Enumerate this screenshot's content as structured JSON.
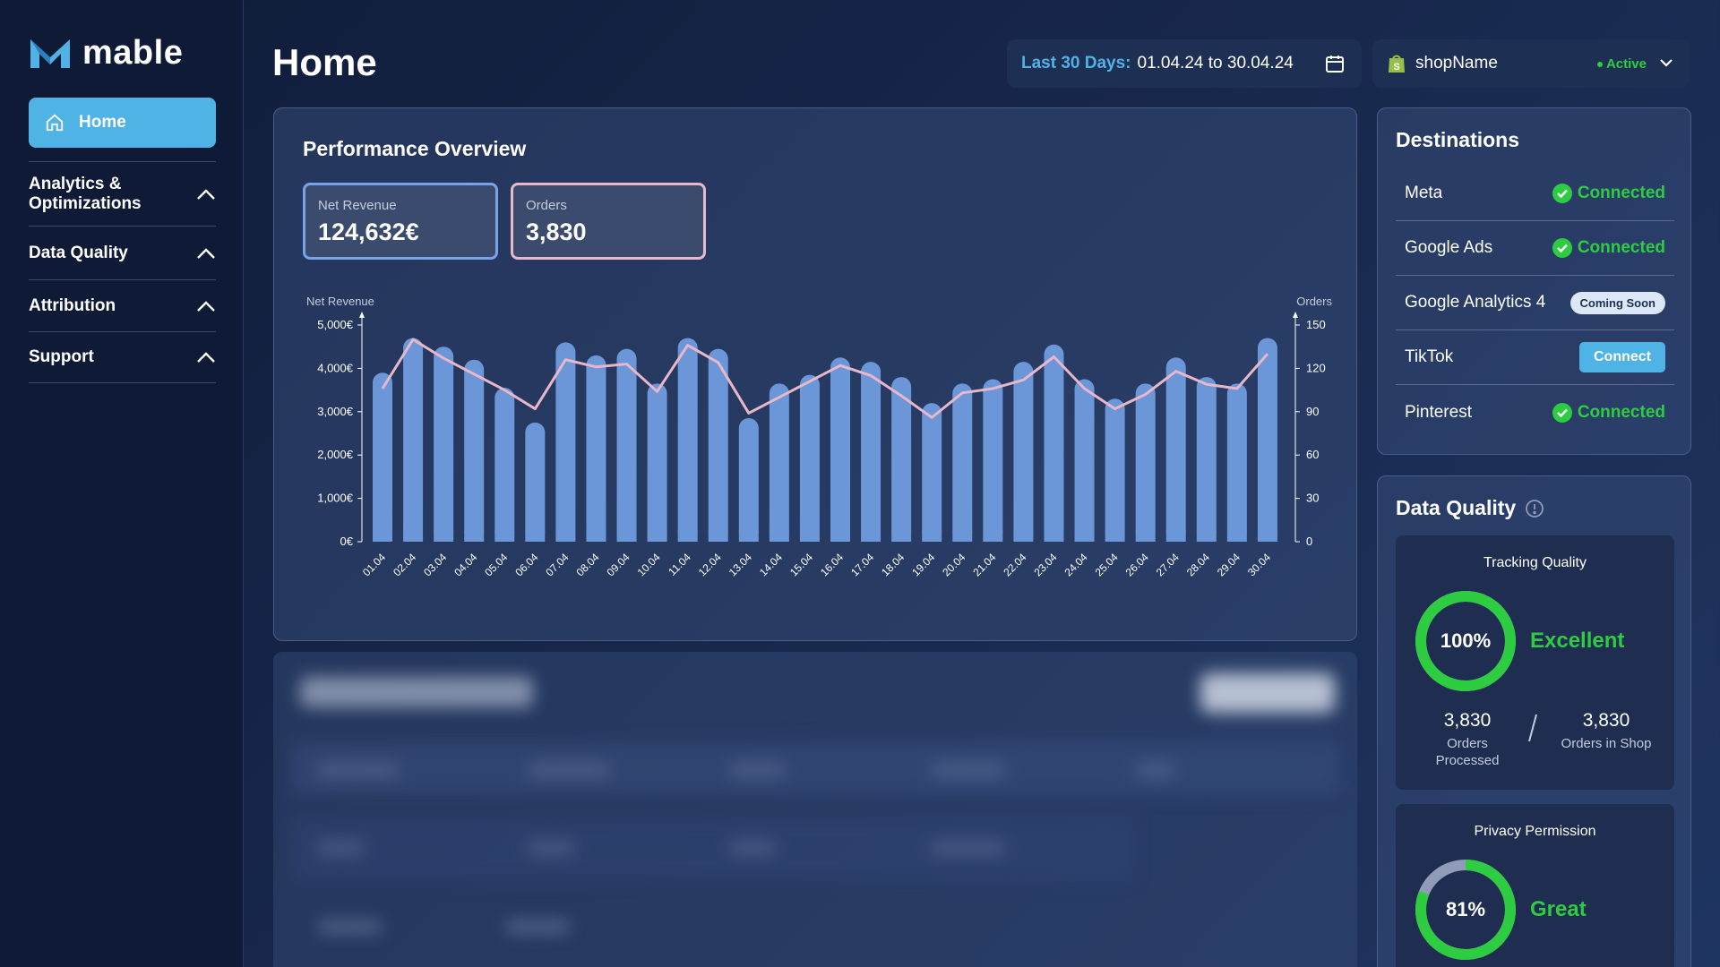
{
  "sidebar": {
    "brand": "mable",
    "home_label": "Home",
    "sections": [
      {
        "label_lines": [
          "Analytics &",
          "Optimizations"
        ]
      },
      {
        "label_lines": [
          "Data Quality"
        ]
      },
      {
        "label_lines": [
          "Attribution"
        ]
      },
      {
        "label_lines": [
          "Support"
        ]
      }
    ]
  },
  "header": {
    "title": "Home",
    "date_label": "Last 30 Days:",
    "date_range": "01.04.24 to 30.04.24",
    "shop_name": "shopName",
    "shop_status": "Active"
  },
  "performance": {
    "title": "Performance Overview",
    "kpis": [
      {
        "label": "Net Revenue",
        "value": "124,632€",
        "color": "#7aa2e8"
      },
      {
        "label": "Orders",
        "value": "3,830",
        "color": "#e8b7c9"
      }
    ]
  },
  "chart_data": {
    "type": "bar",
    "categories": [
      "01.04",
      "02.04",
      "03.04",
      "04.04",
      "05.04",
      "06.04",
      "07.04",
      "08.04",
      "09.04",
      "10.04",
      "11.04",
      "12.04",
      "13.04",
      "14.04",
      "15.04",
      "16.04",
      "17.04",
      "18.04",
      "19.04",
      "20.04",
      "21.04",
      "22.04",
      "23.04",
      "24.04",
      "25.04",
      "26.04",
      "27.04",
      "28.04",
      "29.04",
      "30.04"
    ],
    "series": [
      {
        "name": "Net Revenue",
        "axis": "left",
        "kind": "bar",
        "color": "#6b97d8",
        "values": [
          3900,
          4700,
          4500,
          4200,
          3550,
          2750,
          4600,
          4300,
          4450,
          3650,
          4700,
          4450,
          2850,
          3650,
          3850,
          4250,
          4150,
          3800,
          3200,
          3650,
          3750,
          4150,
          4550,
          3750,
          3300,
          3650,
          4250,
          3800,
          3650,
          4700
        ]
      },
      {
        "name": "Orders",
        "axis": "right",
        "kind": "line",
        "color": "#e8b7c9",
        "values": [
          106,
          140,
          127,
          116,
          105,
          92,
          126,
          121,
          123,
          104,
          136,
          124,
          89,
          100,
          111,
          122,
          115,
          101,
          86,
          103,
          106,
          112,
          128,
          106,
          92,
          102,
          118,
          109,
          106,
          130
        ]
      }
    ],
    "ylabel": "Net Revenue",
    "y2label": "Orders",
    "ylim": [
      0,
      5000
    ],
    "y2lim": [
      0,
      150
    ],
    "yticks": [
      "0€",
      "1,000€",
      "2,000€",
      "3,000€",
      "4,000€",
      "5,000€"
    ],
    "y2ticks": [
      "0",
      "30",
      "60",
      "90",
      "120",
      "150"
    ]
  },
  "destinations": {
    "title": "Destinations",
    "items": [
      {
        "name": "Meta",
        "status": "Connected",
        "type": "connected"
      },
      {
        "name": "Google Ads",
        "status": "Connected",
        "type": "connected"
      },
      {
        "name": "Google Analytics 4",
        "status": "Coming Soon",
        "type": "soon"
      },
      {
        "name": "TikTok",
        "status": "Connect",
        "type": "button"
      },
      {
        "name": "Pinterest",
        "status": "Connected",
        "type": "connected"
      }
    ]
  },
  "data_quality": {
    "title": "Data Quality",
    "tracking": {
      "title": "Tracking Quality",
      "percent_label": "100%",
      "level": 1.0,
      "rating": "Excellent",
      "processed_value": "3,830",
      "processed_label": [
        "Orders",
        "Processed"
      ],
      "shop_value": "3,830",
      "shop_label": "Orders in Shop"
    },
    "privacy": {
      "title": "Privacy Permission",
      "percent_label": "81%",
      "level": 0.81,
      "rating": "Great"
    }
  },
  "colors": {
    "accent": "#4fb3e6",
    "success": "#2ecc40"
  }
}
